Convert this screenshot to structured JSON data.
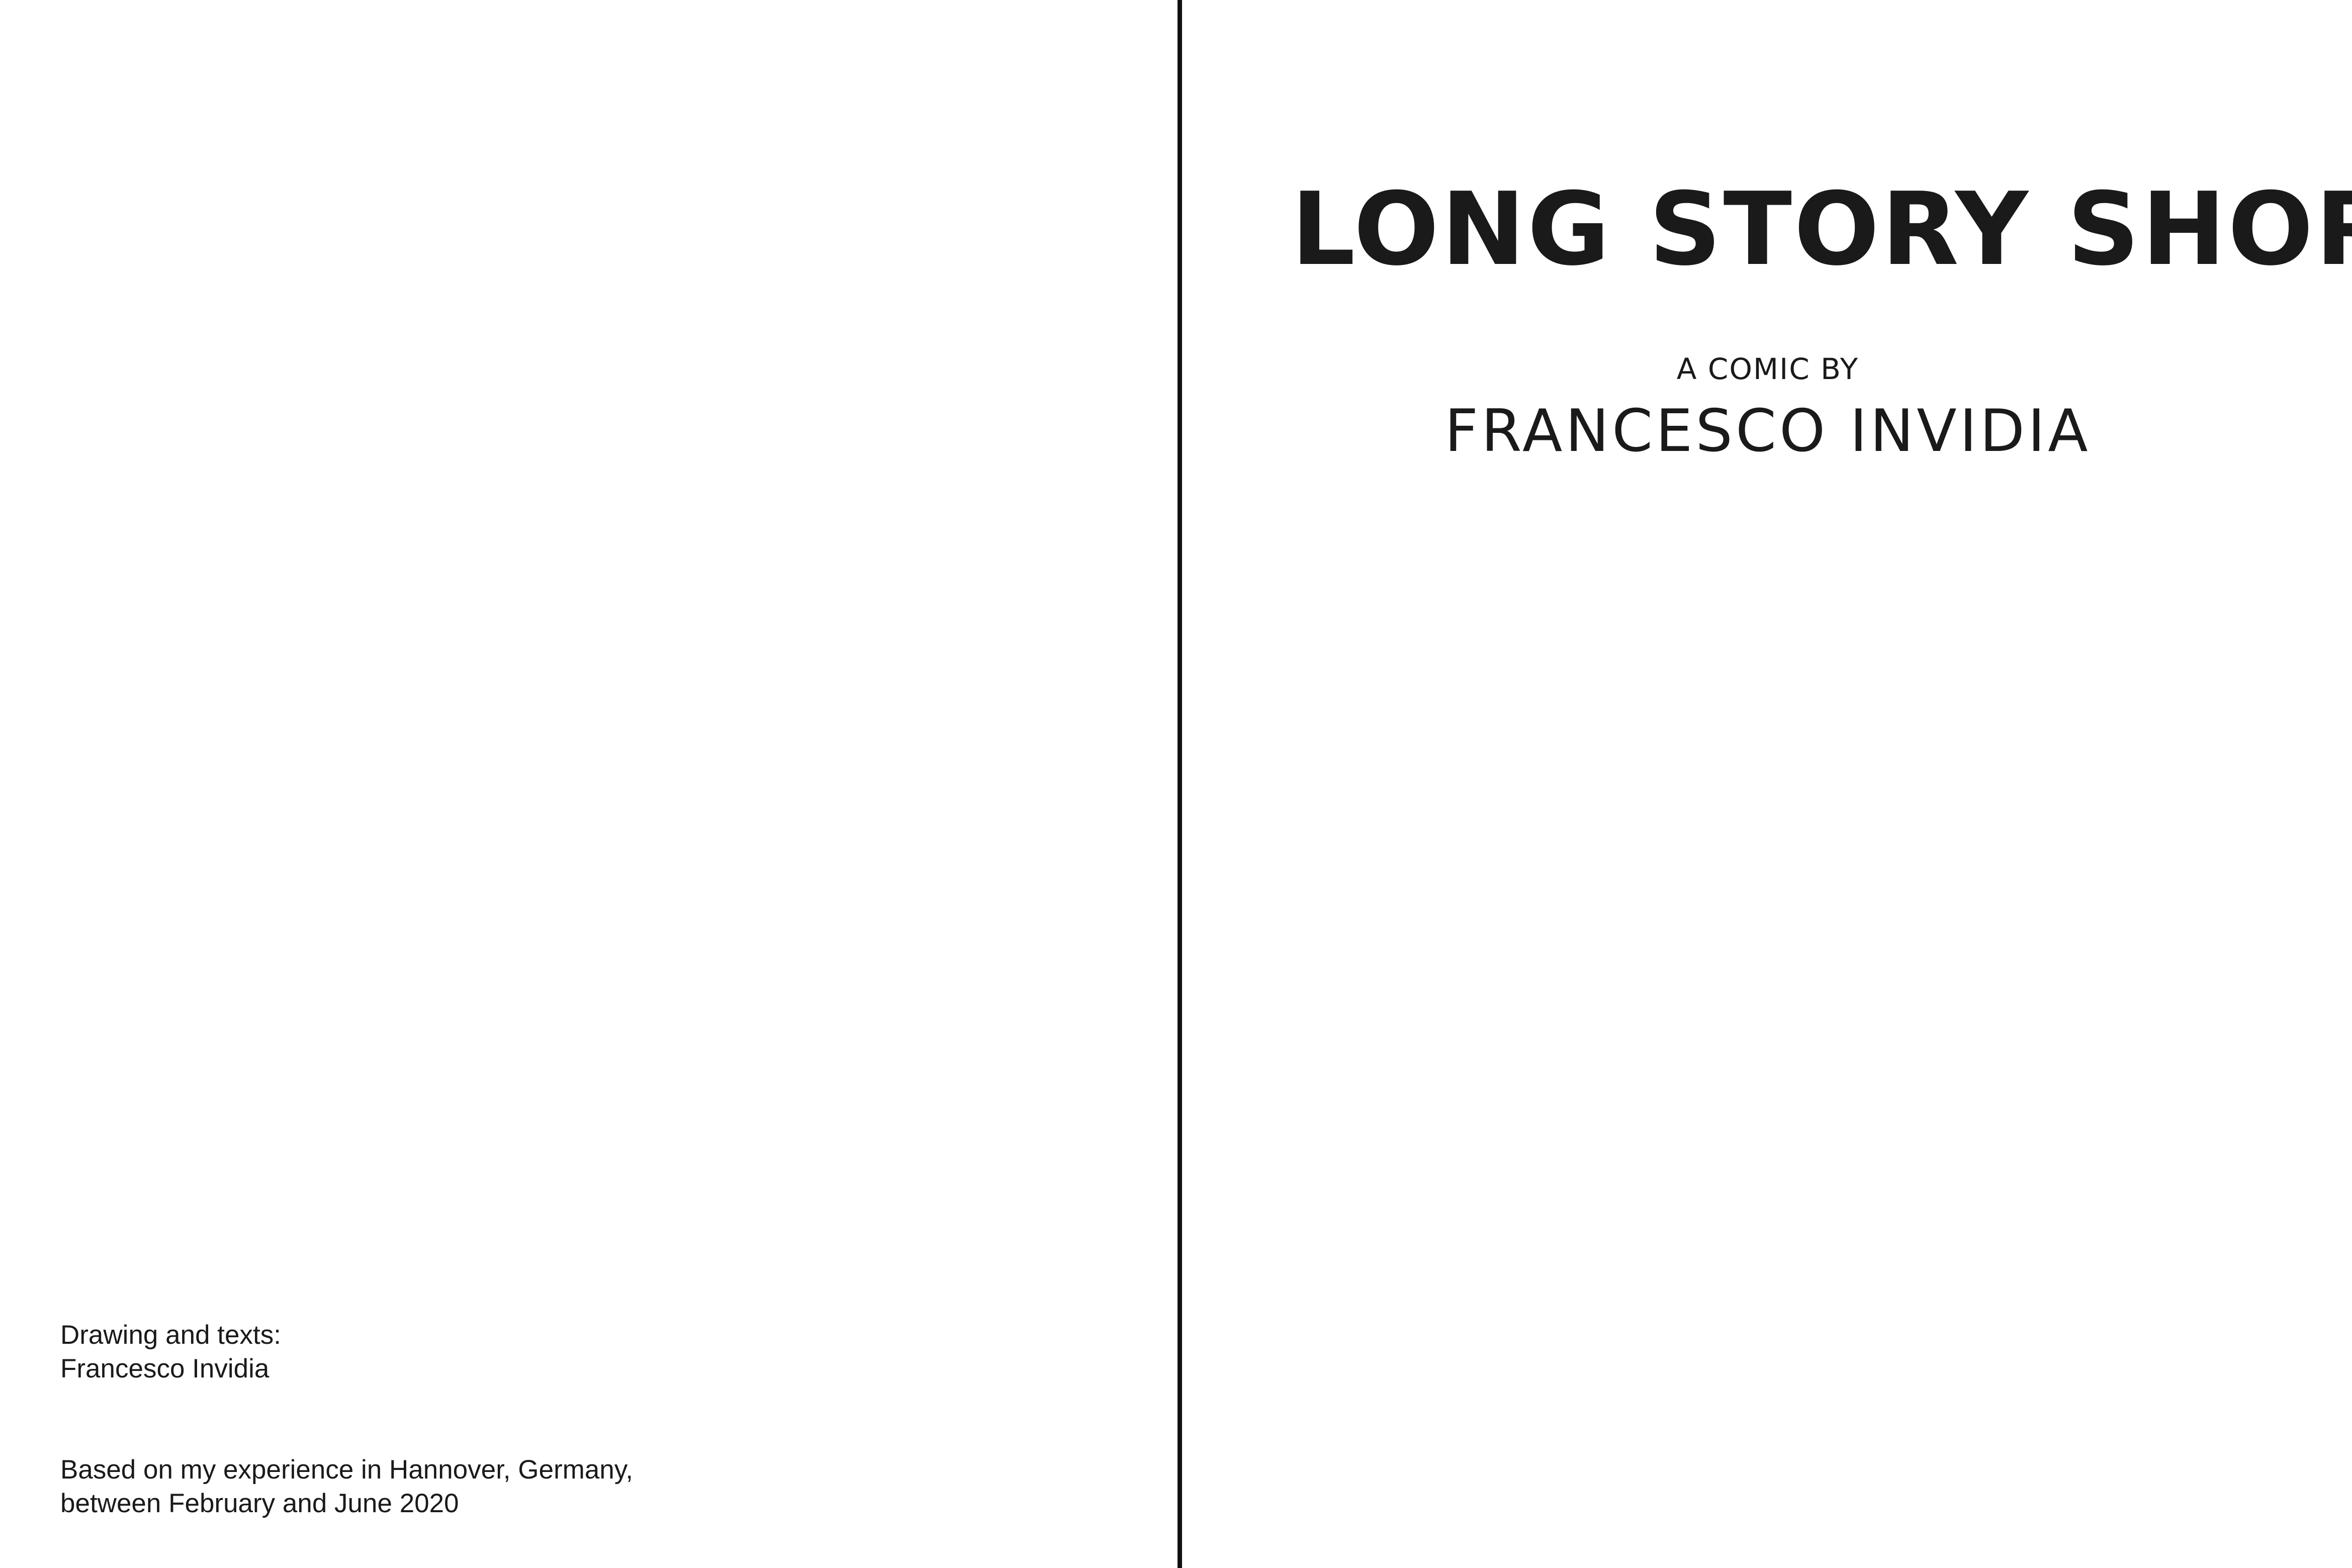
{
  "left_page": {
    "credits_line_1": "Drawing and texts:",
    "credits_line_2": "Francesco Invidia",
    "note_line_1": "Based on my experience in Hannover, Germany,",
    "note_line_2": "between February and June 2020"
  },
  "right_page": {
    "title": "LONG STORY SHORT",
    "byline": "A COMIC BY",
    "author": "FRANCESCO INVIDIA"
  },
  "colors": {
    "ink": "#1a1a1a",
    "paper": "#ffffff"
  }
}
